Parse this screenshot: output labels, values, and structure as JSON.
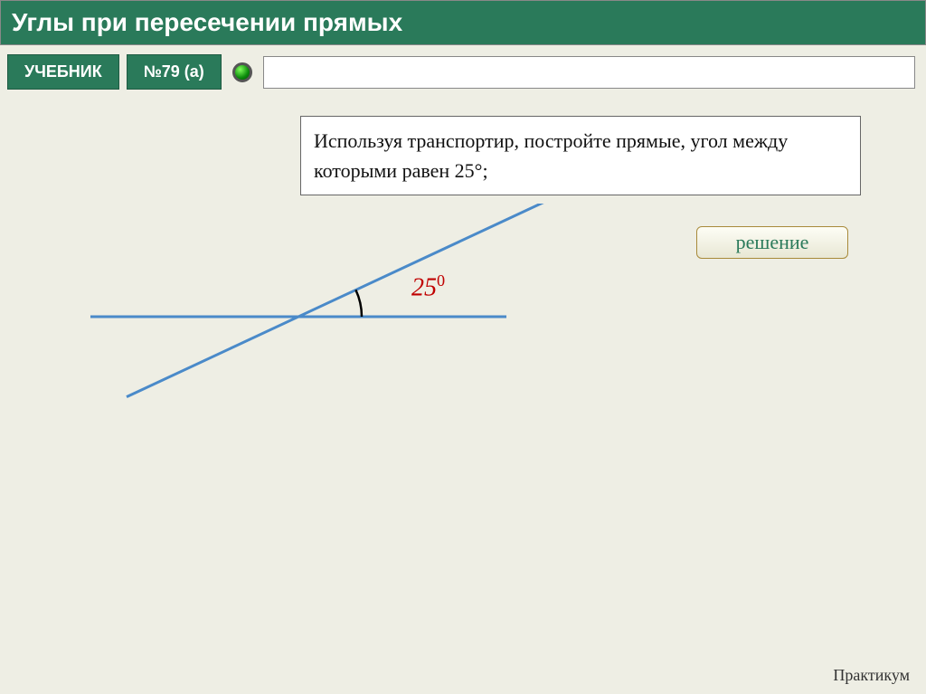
{
  "title": "Углы при пересечении прямых",
  "toolbar": {
    "textbook_label": "УЧЕБНИК",
    "problem_label": "№79 (а)"
  },
  "task_text": "Используя транспортир, постройте прямые, угол между которыми равен 25°;",
  "solution_label": "решение",
  "angle": {
    "value": "25",
    "degree_symbol": "0"
  },
  "footer": "Практикум",
  "chart_data": {
    "type": "diagram",
    "description": "Two intersecting straight lines with marked angle",
    "lines": [
      {
        "name": "horizontal",
        "angle_deg": 0
      },
      {
        "name": "oblique",
        "angle_deg": 25
      }
    ],
    "marked_angle_deg": 25,
    "angle_label": "25°",
    "colors": {
      "line": "#4a8ac9",
      "arc": "#000000",
      "label": "#c00000"
    }
  }
}
